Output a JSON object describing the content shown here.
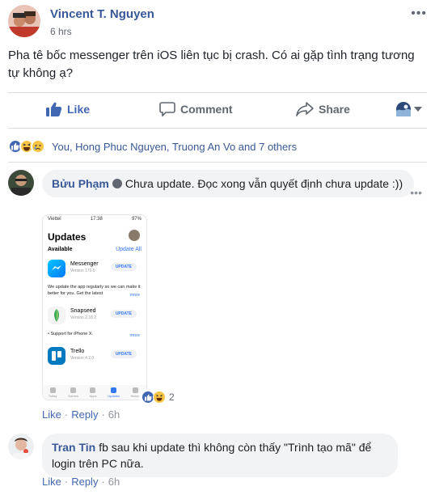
{
  "post": {
    "author": "Vincent T. Nguyen",
    "time": "6 hrs",
    "menu": "•••",
    "text": "Pha tê bốc messenger trên iOS liên tục bị crash. Có ai gặp tình trạng tương tự không ạ?"
  },
  "actions": {
    "like": "Like",
    "comment": "Comment",
    "share": "Share"
  },
  "reactions": {
    "summary": "You, Hong Phuc Nguyen, Truong An Vo and 7 others"
  },
  "comments": [
    {
      "name": "Bửu Phạm",
      "text": "Chưa update. Đọc xong vẫn quyết định chưa update :))",
      "like": "Like",
      "reply": "Reply",
      "time": "6h",
      "reaction_count": "2",
      "menu": "•••"
    },
    {
      "name": "Tran Tin",
      "text": "fb sau khi update thì không còn thấy \"Trình tạo mã\" để login trên PC nữa.",
      "like": "Like",
      "reply": "Reply",
      "time": "6h"
    }
  ],
  "screenshot": {
    "carrier": "Viettel",
    "clock": "17:38",
    "battery": "97%",
    "title": "Updates",
    "available": "Available",
    "update_all": "Update All",
    "apps": [
      {
        "name": "Messenger",
        "version": "Version 170.0",
        "button": "UPDATE"
      },
      {
        "name": "Snapseed",
        "version": "Version 2.18.2",
        "button": "UPDATE"
      },
      {
        "name": "Trello",
        "version": "Version 4.2.0",
        "button": "UPDATE"
      }
    ],
    "desc1": "We update the app regularly so we can make it better for you. Get the latest",
    "desc2": "• Support for iPhone X.",
    "more": "more",
    "tabs": [
      "Today",
      "Games",
      "Apps",
      "Updates",
      "Search"
    ]
  },
  "colors": {
    "link": "#385898",
    "like_blue": "#4267b2",
    "bubble": "#f2f3f5"
  }
}
